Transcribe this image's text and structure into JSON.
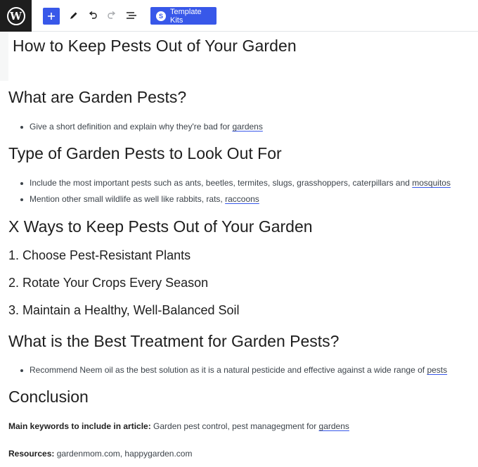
{
  "toolbar": {
    "logo_text": "W",
    "template_kits_label": "Template Kits",
    "template_kits_icon_text": "S",
    "icons": [
      "wordpress-icon",
      "plus-icon",
      "pencil-icon",
      "undo-icon",
      "redo-icon",
      "list-view-icon"
    ]
  },
  "document": {
    "title": "How to Keep Pests Out of Your Garden",
    "sections": {
      "s1_heading": "What are Garden Pests?",
      "s1_bullet1_text": "Give a short definition and explain why they're bad for ",
      "s1_bullet1_link": "gardens",
      "s2_heading": "Type of Garden Pests to Look Out For",
      "s2_bullet1_text": "Include the most important pests such as ants, beetles, termites, slugs, grasshoppers, caterpillars and ",
      "s2_bullet1_link": "mosquitos",
      "s2_bullet2_text": "Mention other small wildlife as well like rabbits, rats, ",
      "s2_bullet2_link": "raccoons",
      "s3_heading": "X Ways to Keep Pests Out of Your Garden",
      "s3_sub1": "1. Choose Pest-Resistant Plants",
      "s3_sub2": "2. Rotate Your Crops Every Season",
      "s3_sub3": "3. Maintain a Healthy, Well-Balanced Soil",
      "s4_heading": "What is the Best Treatment for Garden Pests?",
      "s4_bullet1_text": "Recommend Neem oil as the best solution as it is a natural pesticide and effective against a wide range of ",
      "s4_bullet1_link": "pests",
      "s5_heading": "Conclusion",
      "keywords_label": "Main keywords to include in article:",
      "keywords_text": " Garden pest control, pest managegment for ",
      "keywords_link": "gardens",
      "resources_label": "Resources:",
      "resources_text": " gardenmom.com, happygarden.com"
    }
  },
  "colors": {
    "accent": "#3858e9",
    "logo_bg": "#1e1e1e",
    "text": "#1e1e1e",
    "body_text": "#3c434a"
  }
}
